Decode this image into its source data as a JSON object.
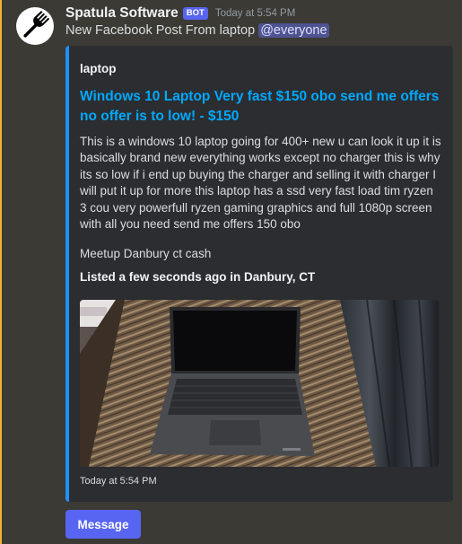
{
  "colors": {
    "background": "#313338",
    "highlight": "#3b3a34",
    "highlight_bar": "#f0b232",
    "embed_bg": "#2b2d31",
    "embed_accent": "#1e90ff",
    "link_title": "#00a8fc",
    "blurple": "#5865f2",
    "mention_bg": "#4e5391"
  },
  "message": {
    "avatar_icon": "fork-icon",
    "username": "Spatula Software",
    "bot_tag": "BOT",
    "timestamp": "Today at 5:54 PM",
    "content_text": "New Facebook Post From laptop ",
    "mention": "@everyone"
  },
  "embed": {
    "author": "laptop",
    "title": "Windows 10 Laptop Very fast $150 obo send me offers no offer is to low! - $150",
    "description": "This is a windows 10 laptop going for 400+ new u can look it up it is basically brand new everything works except no charger this is why its so low if i end up buying the charger and selling it with charger I will put it up for more this laptop has a ssd very fast load tim ryzen 3 cou very powerfull ryzen gaming graphics and full 1080p screen with all you need send me offers 150 obo",
    "meetup": "Meetup Danbury ct cash",
    "listed": "Listed a few seconds ago in Danbury, CT",
    "footer_timestamp": "Today at 5:54 PM",
    "image_subject": "laptop-photo"
  },
  "buttons": {
    "message_label": "Message"
  }
}
